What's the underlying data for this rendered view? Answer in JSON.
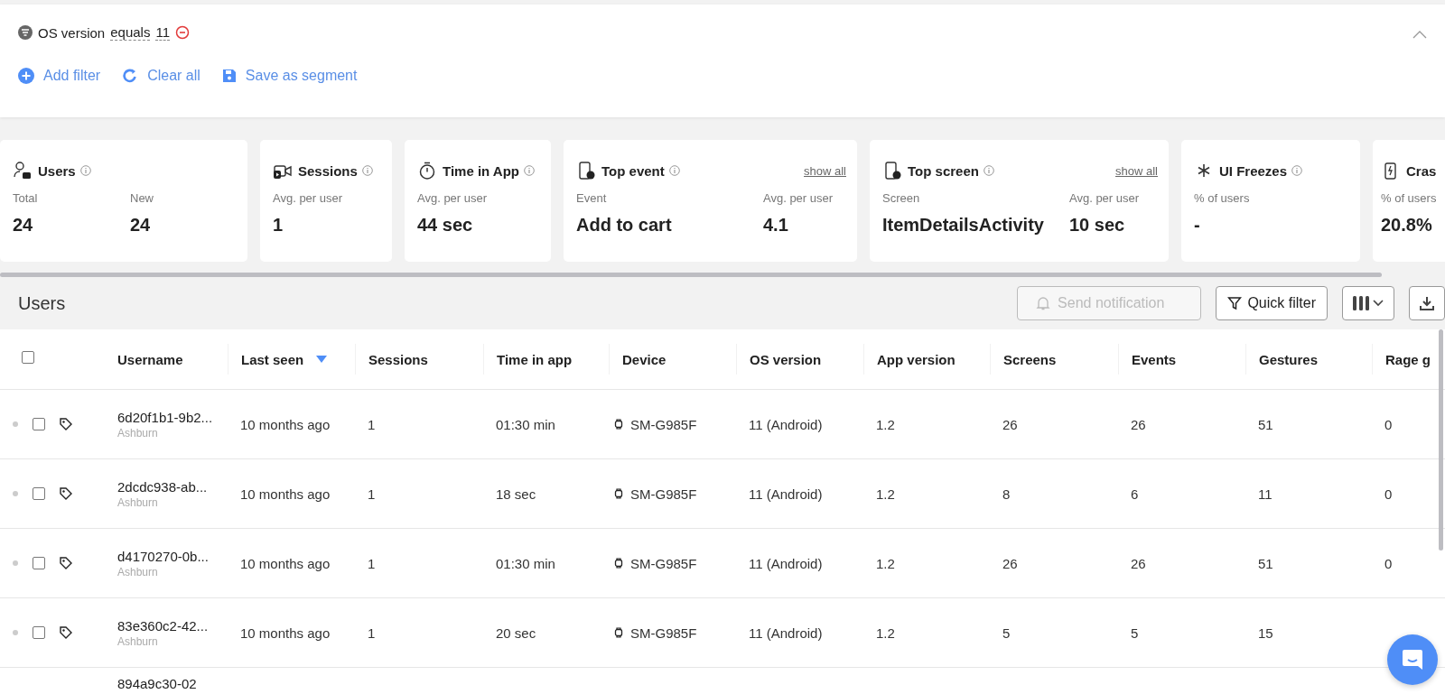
{
  "filter_bar": {
    "conditions": [
      {
        "field": "OS version",
        "operator": "equals",
        "value": "11"
      }
    ],
    "actions": [
      {
        "kind": "add",
        "label": "Add filter"
      },
      {
        "kind": "clear",
        "label": "Clear all"
      },
      {
        "kind": "save",
        "label": "Save as segment"
      }
    ]
  },
  "stat_cards": [
    {
      "kind": "users",
      "title": "Users",
      "metrics": [
        {
          "label": "Total",
          "value": "24"
        },
        {
          "label": "New",
          "value": "24"
        }
      ]
    },
    {
      "kind": "sessions",
      "title": "Sessions",
      "metrics": [
        {
          "label": "Avg. per user",
          "value": "1"
        }
      ]
    },
    {
      "kind": "time",
      "title": "Time in App",
      "metrics": [
        {
          "label": "Avg. per user",
          "value": "44 sec"
        }
      ]
    },
    {
      "kind": "event",
      "title": "Top event",
      "link": "show all",
      "metrics": [
        {
          "label": "Event",
          "value": "Add to cart"
        },
        {
          "label": "Avg. per user",
          "value": "4.1"
        }
      ]
    },
    {
      "kind": "screen",
      "title": "Top screen",
      "link": "show all",
      "metrics": [
        {
          "label": "Screen",
          "value": "ItemDetailsActivity"
        },
        {
          "label": "Avg. per user",
          "value": "10 sec"
        }
      ]
    },
    {
      "kind": "freeze",
      "title": "UI Freezes",
      "metrics": [
        {
          "label": "% of users",
          "value": "-"
        }
      ]
    },
    {
      "kind": "crash",
      "title": "Cras",
      "metrics": [
        {
          "label": "% of users",
          "value": "20.8%"
        }
      ]
    }
  ],
  "users_section": {
    "title": "Users",
    "buttons": [
      {
        "kind": "notify",
        "label": "Send notification",
        "disabled": true
      },
      {
        "kind": "filter",
        "label": "Quick filter",
        "disabled": false
      },
      {
        "kind": "columns",
        "disabled": false
      },
      {
        "kind": "download",
        "disabled": false
      }
    ]
  },
  "table": {
    "select_all": {
      "checked": false
    },
    "columns": [
      {
        "label": "Username",
        "sorted": false
      },
      {
        "label": "Last seen",
        "sorted": true
      },
      {
        "label": "Sessions",
        "sorted": false
      },
      {
        "label": "Time in app",
        "sorted": false
      },
      {
        "label": "Device",
        "sorted": false
      },
      {
        "label": "OS version",
        "sorted": false
      },
      {
        "label": "App version",
        "sorted": false
      },
      {
        "label": "Screens",
        "sorted": false
      },
      {
        "label": "Events",
        "sorted": false
      },
      {
        "label": "Gestures",
        "sorted": false
      },
      {
        "label": "Rage g",
        "sorted": false
      }
    ],
    "rows": [
      {
        "checked": false,
        "username": "6d20f1b1-9b2...",
        "location": "Ashburn",
        "cells": [
          "10 months ago",
          "1",
          "01:30 min",
          "SM-G985F",
          "11 (Android)",
          "1.2",
          "26",
          "26",
          "51",
          "0"
        ]
      },
      {
        "checked": false,
        "username": "2dcdc938-ab...",
        "location": "Ashburn",
        "cells": [
          "10 months ago",
          "1",
          "18 sec",
          "SM-G985F",
          "11 (Android)",
          "1.2",
          "8",
          "6",
          "11",
          "0"
        ]
      },
      {
        "checked": false,
        "username": "d4170270-0b...",
        "location": "Ashburn",
        "cells": [
          "10 months ago",
          "1",
          "01:30 min",
          "SM-G985F",
          "11 (Android)",
          "1.2",
          "26",
          "26",
          "51",
          "0"
        ]
      },
      {
        "checked": false,
        "username": "83e360c2-42...",
        "location": "Ashburn",
        "cells": [
          "10 months ago",
          "1",
          "20 sec",
          "SM-G985F",
          "11 (Android)",
          "1.2",
          "5",
          "5",
          "15"
        ]
      },
      {
        "username": "894a9c30-02"
      }
    ]
  }
}
